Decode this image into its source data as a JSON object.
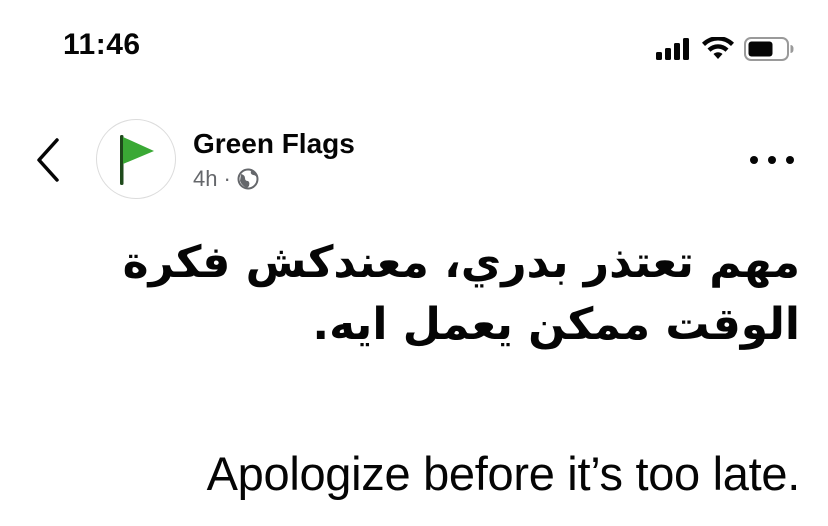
{
  "status_bar": {
    "time": "11:46",
    "icons": [
      "cellular-signal-icon",
      "wifi-icon",
      "battery-icon"
    ]
  },
  "nav": {
    "back_icon": "chevron-left-icon",
    "more_icon": "ellipsis-icon"
  },
  "post": {
    "author": "Green Flags",
    "avatar_icon": "green-flag-icon",
    "avatar_color": "#3aa935",
    "time_ago": "4h",
    "separator": "·",
    "privacy_icon": "globe-icon",
    "arabic_line_1": "مهم تعتذر بدري، معندكش فكرة",
    "arabic_line_2": "الوقت ممكن يعمل ايه.",
    "english_text": "Apologize before it’s too late."
  }
}
